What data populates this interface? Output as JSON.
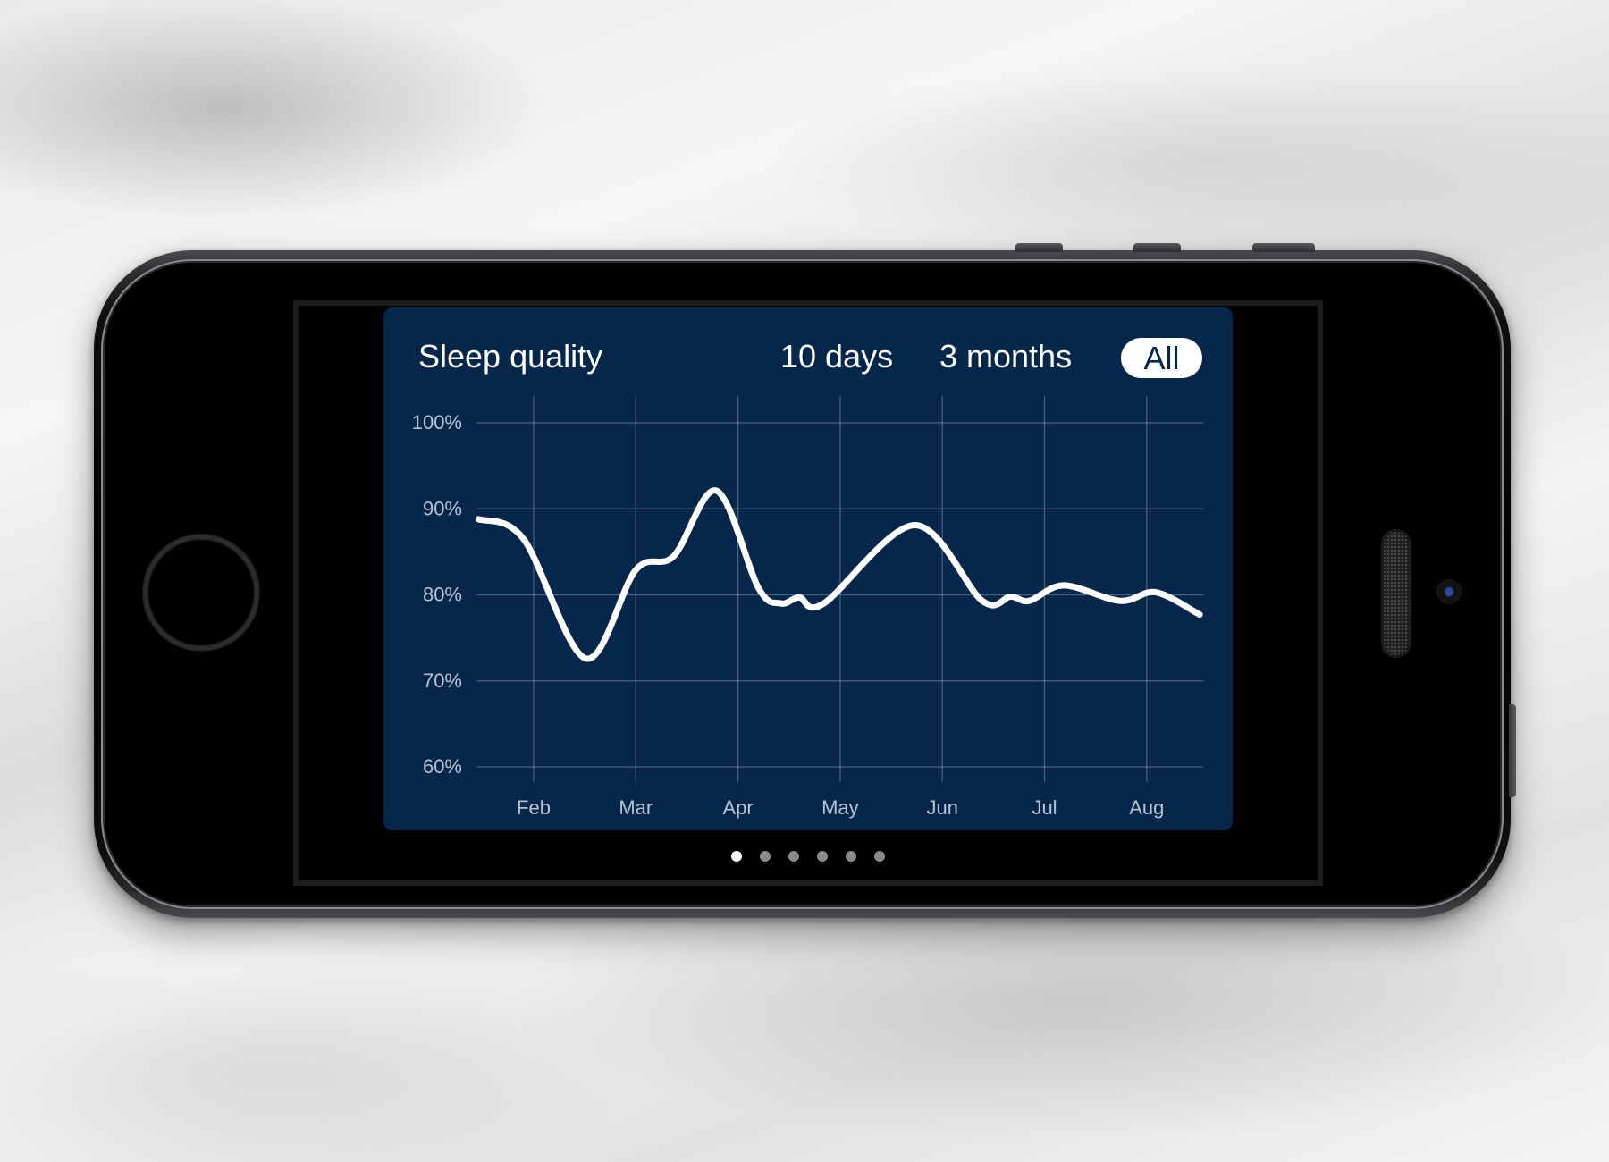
{
  "card": {
    "title": "Sleep quality",
    "ranges": [
      {
        "label": "10 days",
        "selected": false
      },
      {
        "label": "3 months",
        "selected": false
      },
      {
        "label": "All",
        "selected": true
      }
    ],
    "background_color": "#06264a",
    "line_color": "#ffffff"
  },
  "pagination": {
    "count": 6,
    "active_index": 0
  },
  "chart_data": {
    "type": "line",
    "title": "Sleep quality",
    "xlabel": "",
    "ylabel": "",
    "x_unit": "month index (Feb = 1)",
    "x_ticks": [
      {
        "label": "Feb",
        "value": 1
      },
      {
        "label": "Mar",
        "value": 2
      },
      {
        "label": "Apr",
        "value": 3
      },
      {
        "label": "May",
        "value": 4
      },
      {
        "label": "Jun",
        "value": 5
      },
      {
        "label": "Jul",
        "value": 6
      },
      {
        "label": "Aug",
        "value": 7
      }
    ],
    "y_ticks": [
      {
        "label": "100%",
        "value": 100
      },
      {
        "label": "90%",
        "value": 90
      },
      {
        "label": "80%",
        "value": 80
      },
      {
        "label": "70%",
        "value": 70
      },
      {
        "label": "60%",
        "value": 60
      }
    ],
    "xlim": [
      0.46,
      7.52
    ],
    "ylim": [
      60,
      100
    ],
    "grid": true,
    "smooth": true,
    "series": [
      {
        "name": "Sleep quality",
        "points": [
          [
            0.46,
            88.8
          ],
          [
            0.9,
            86.5
          ],
          [
            1.51,
            72.6
          ],
          [
            2.0,
            82.9
          ],
          [
            2.37,
            84.5
          ],
          [
            2.79,
            92.1
          ],
          [
            3.2,
            80.8
          ],
          [
            3.42,
            79.0
          ],
          [
            3.6,
            79.7
          ],
          [
            3.84,
            79.0
          ],
          [
            4.73,
            88.1
          ],
          [
            5.39,
            79.3
          ],
          [
            5.67,
            79.8
          ],
          [
            5.85,
            79.3
          ],
          [
            6.19,
            81.1
          ],
          [
            6.74,
            79.3
          ],
          [
            7.09,
            80.3
          ],
          [
            7.52,
            77.7
          ]
        ]
      }
    ]
  }
}
